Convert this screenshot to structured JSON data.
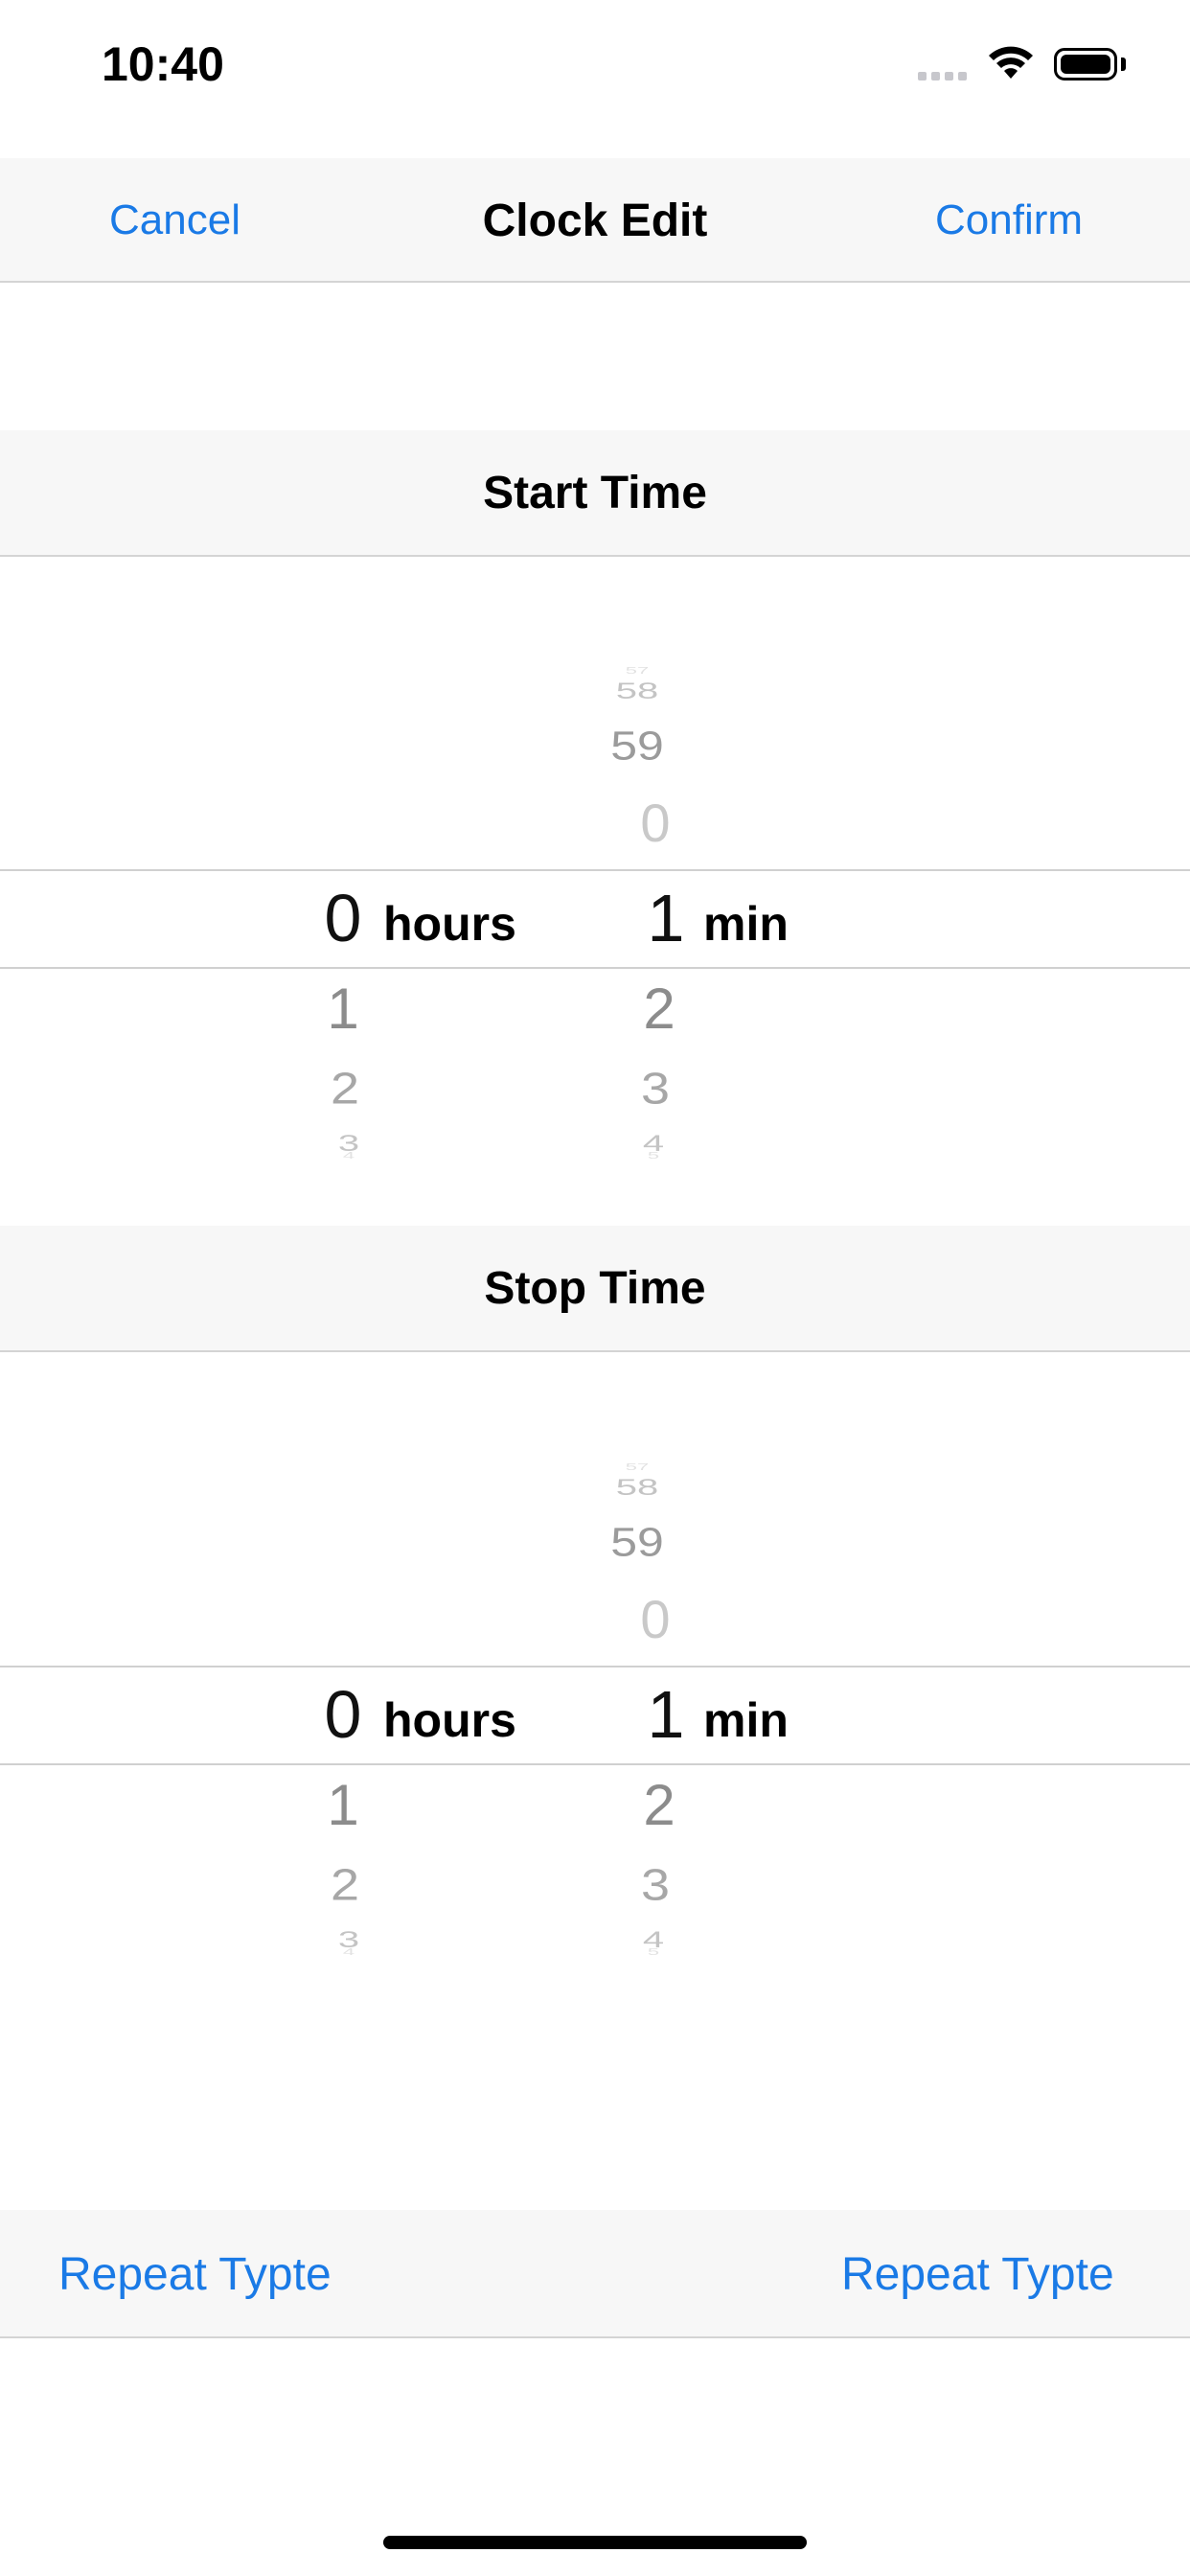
{
  "status_bar": {
    "time": "10:40",
    "icons": [
      "signal-icon",
      "wifi-icon",
      "battery-icon"
    ]
  },
  "nav": {
    "cancel_label": "Cancel",
    "title": "Clock Edit",
    "confirm_label": "Confirm"
  },
  "start": {
    "title": "Start Time",
    "hours": {
      "selected": "0",
      "unit": "hours",
      "below": [
        "1",
        "2",
        "3",
        "4"
      ]
    },
    "minutes": {
      "above": [
        "57",
        "58",
        "59",
        "0"
      ],
      "selected": "1",
      "unit": "min",
      "below": [
        "2",
        "3",
        "4",
        "5"
      ]
    }
  },
  "stop": {
    "title": "Stop Time",
    "hours": {
      "selected": "0",
      "unit": "hours",
      "below": [
        "1",
        "2",
        "3",
        "4"
      ]
    },
    "minutes": {
      "above": [
        "57",
        "58",
        "59",
        "0"
      ],
      "selected": "1",
      "unit": "min",
      "below": [
        "2",
        "3",
        "4",
        "5"
      ]
    }
  },
  "repeat": {
    "left_label": "Repeat Typte",
    "right_label": "Repeat Typte"
  },
  "colors": {
    "accent": "#1a7ae6",
    "bar_bg": "#f7f7f7",
    "separator": "#d4d4d4"
  }
}
